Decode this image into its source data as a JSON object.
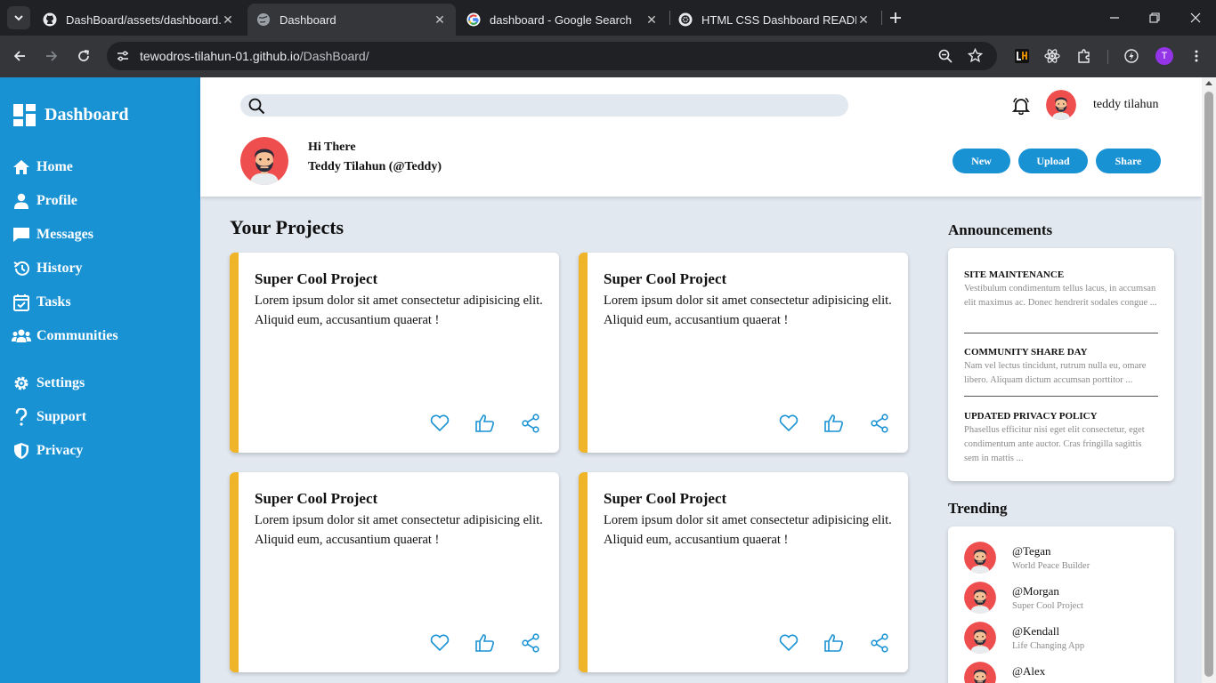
{
  "browser": {
    "tabs": [
      {
        "title": "DashBoard/assets/dashboard.png",
        "favicon": "github-icon",
        "active": false
      },
      {
        "title": "Dashboard",
        "favicon": "globe-icon",
        "active": true
      },
      {
        "title": "dashboard - Google Search",
        "favicon": "google-icon",
        "active": false
      },
      {
        "title": "HTML CSS Dashboard README",
        "favicon": "openai-icon",
        "active": false
      }
    ],
    "url_host": "tewodros-tilahun-01.github.io",
    "url_path": "/DashBoard/",
    "profile_initial": "T"
  },
  "sidebar": {
    "brand": "Dashboard",
    "items": [
      {
        "label": "Home",
        "icon": "home-icon"
      },
      {
        "label": "Profile",
        "icon": "user-icon"
      },
      {
        "label": "Messages",
        "icon": "chat-icon"
      },
      {
        "label": "History",
        "icon": "history-icon"
      },
      {
        "label": "Tasks",
        "icon": "calendar-check-icon"
      },
      {
        "label": "Communities",
        "icon": "users-icon"
      },
      {
        "label": "Settings",
        "icon": "gear-icon"
      },
      {
        "label": "Support",
        "icon": "question-icon"
      },
      {
        "label": "Privacy",
        "icon": "shield-icon"
      }
    ]
  },
  "header": {
    "search_placeholder": "",
    "username": "teddy tilahun",
    "greeting": "Hi There",
    "fullname": "Teddy Tilahun (@Teddy)",
    "buttons": {
      "new": "New",
      "upload": "Upload",
      "share": "Share"
    }
  },
  "projects": {
    "title": "Your Projects",
    "cards": [
      {
        "title": "Super Cool Project",
        "description": "Lorem ipsum dolor sit amet consectetur adipisicing elit. Aliquid eum, accusantium quaerat !"
      },
      {
        "title": "Super Cool Project",
        "description": "Lorem ipsum dolor sit amet consectetur adipisicing elit. Aliquid eum, accusantium quaerat !"
      },
      {
        "title": "Super Cool Project",
        "description": "Lorem ipsum dolor sit amet consectetur adipisicing elit. Aliquid eum, accusantium quaerat !"
      },
      {
        "title": "Super Cool Project",
        "description": "Lorem ipsum dolor sit amet consectetur adipisicing elit. Aliquid eum, accusantium quaerat !"
      }
    ]
  },
  "announcements": {
    "title": "Announcements",
    "items": [
      {
        "title": "SITE MAINTENANCE",
        "text": "Vestibulum condimentum tellus lacus, in accumsan elit maximus ac. Donec hendrerit sodales congue ..."
      },
      {
        "title": "COMMUNITY SHARE DAY",
        "text": "Nam vel lectus tincidunt, rutrum nulla eu, omare libero. Aliquam dictum accumsan porttitor ..."
      },
      {
        "title": "UPDATED PRIVACY POLICY",
        "text": "Phasellus efficitur nisi eget elit consectetur, eget condimentum ante auctor. Cras fringilla sagittis sem in mattis ..."
      }
    ]
  },
  "trending": {
    "title": "Trending",
    "items": [
      {
        "handle": "@Tegan",
        "project": "World Peace Builder"
      },
      {
        "handle": "@Morgan",
        "project": "Super Cool Project"
      },
      {
        "handle": "@Kendall",
        "project": "Life Changing App"
      },
      {
        "handle": "@Alex",
        "project": ""
      }
    ]
  },
  "colors": {
    "sidebar": "#1992d4",
    "accent": "#f0b429",
    "page_bg": "#e2e8f0",
    "avatar_bg": "#ef4e4e"
  }
}
